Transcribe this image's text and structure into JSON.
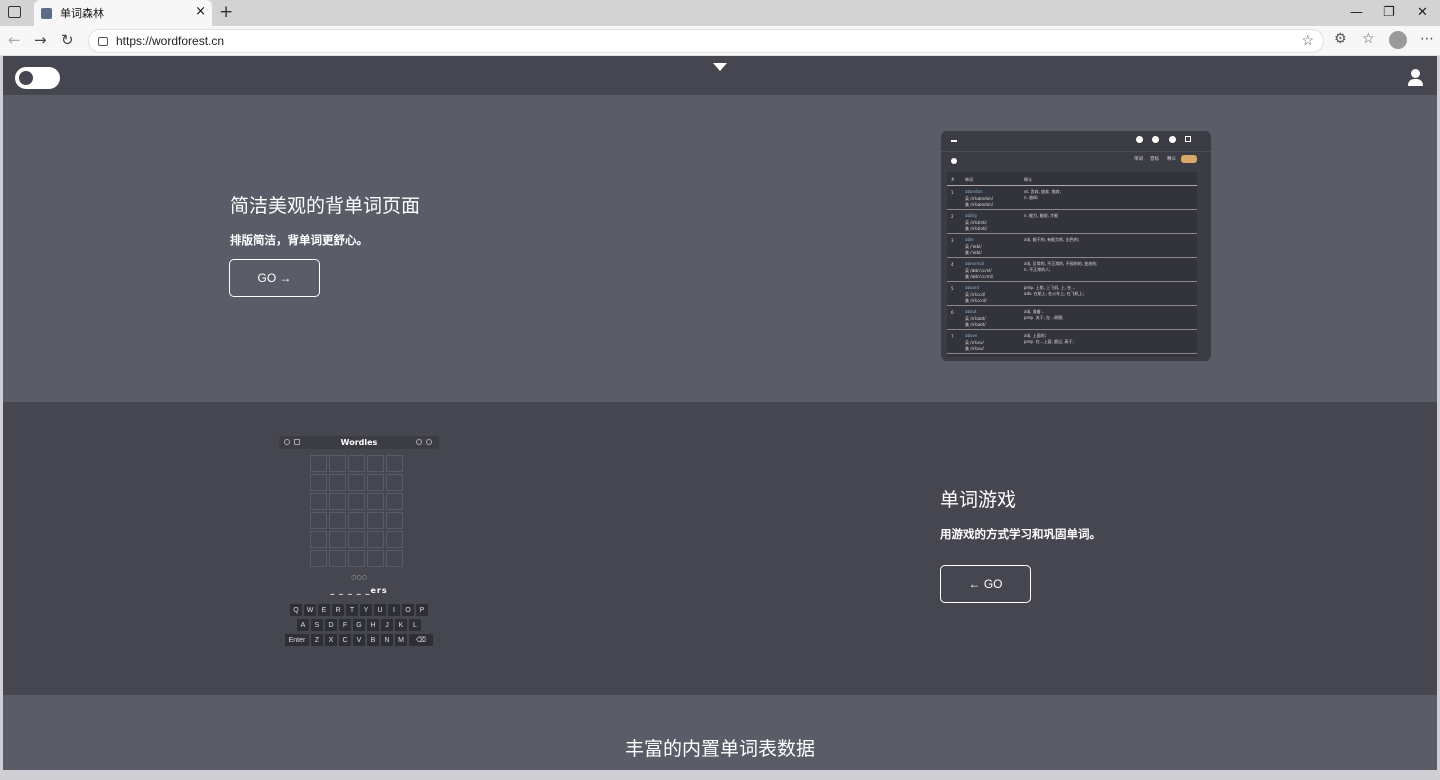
{
  "browser": {
    "tab_title": "单词森林",
    "url": "https://wordforest.cn",
    "new_tab_glyph": "+",
    "close_glyph": "×",
    "minimize_glyph": "—",
    "restore_glyph": "❐",
    "window_close_glyph": "✕"
  },
  "section1": {
    "title": "简洁美观的背单词页面",
    "subtitle": "排版简洁，背单词更舒心。",
    "button": "GO →",
    "preview": {
      "tools": [
        "单词",
        "音标",
        "释义"
      ],
      "headers": [
        "#",
        "单词",
        "释义"
      ],
      "rows": [
        {
          "n": "1",
          "word": "abandon",
          "ph1": "英 /əˈbændən/",
          "ph2": "美 /əˈbændən/",
          "d1": "vt. 丢弃, 放弃, 抛弃;",
          "d2": "n. 放纵;"
        },
        {
          "n": "2",
          "word": "ability",
          "ph1": "英 /əˈbɪləti/",
          "ph2": "美 /əˈbɪləti/",
          "d1": "n. 能力, 能耐, 才能",
          "d2": ""
        },
        {
          "n": "3",
          "word": "able",
          "ph1": "英 /ˈeɪbl/",
          "ph2": "美 /ˈeɪbl/",
          "d1": "adj. 能干的, 有能力的, 出色的;",
          "d2": ""
        },
        {
          "n": "4",
          "word": "abnormal",
          "ph1": "英 /æbˈnɔːml/",
          "ph2": "美 /æbˈnɔːrml/",
          "d1": "adj. 反常的, 不正常的, 不规则的, 变态的;",
          "d2": "n. 不正常的人;"
        },
        {
          "n": "5",
          "word": "aboard",
          "ph1": "英 /əˈbɔːd/",
          "ph2": "美 /əˈbɔːrd/",
          "d1": "prep. 上船, 上飞机, 上, 在...",
          "d2": "adv. 在船上, 在火车上, 在飞机上;"
        },
        {
          "n": "6",
          "word": "about",
          "ph1": "英 /əˈbaʊt/",
          "ph2": "美 /əˈbaʊt/",
          "d1": "adj. 准备...",
          "d2": "prep. 关于, 在...周围;"
        },
        {
          "n": "7",
          "word": "above",
          "ph1": "英 /əˈbʌv/",
          "ph2": "美 /əˈbʌv/",
          "d1": "adj. 上面的;",
          "d2": "prep. 在...上面, 超过, 高于;"
        }
      ]
    }
  },
  "section2": {
    "title": "单词游戏",
    "subtitle": "用游戏的方式学习和巩固单词。",
    "button": "← GO",
    "game": {
      "title": "Wordles",
      "dots": "○○○",
      "hint": "_ _ _ _ _ers",
      "keyboard": [
        [
          "Q",
          "W",
          "E",
          "R",
          "T",
          "Y",
          "U",
          "I",
          "O",
          "P"
        ],
        [
          "A",
          "S",
          "D",
          "F",
          "G",
          "H",
          "J",
          "K",
          "L"
        ],
        [
          "Enter",
          "Z",
          "X",
          "C",
          "V",
          "B",
          "N",
          "M",
          "⌫"
        ]
      ]
    }
  },
  "section3": {
    "title": "丰富的内置单词表数据"
  },
  "colors": {
    "nav": "#45464f",
    "section_light": "#5a5c68",
    "section_dark": "#45464f",
    "accent_pill": "#d8a86a"
  }
}
